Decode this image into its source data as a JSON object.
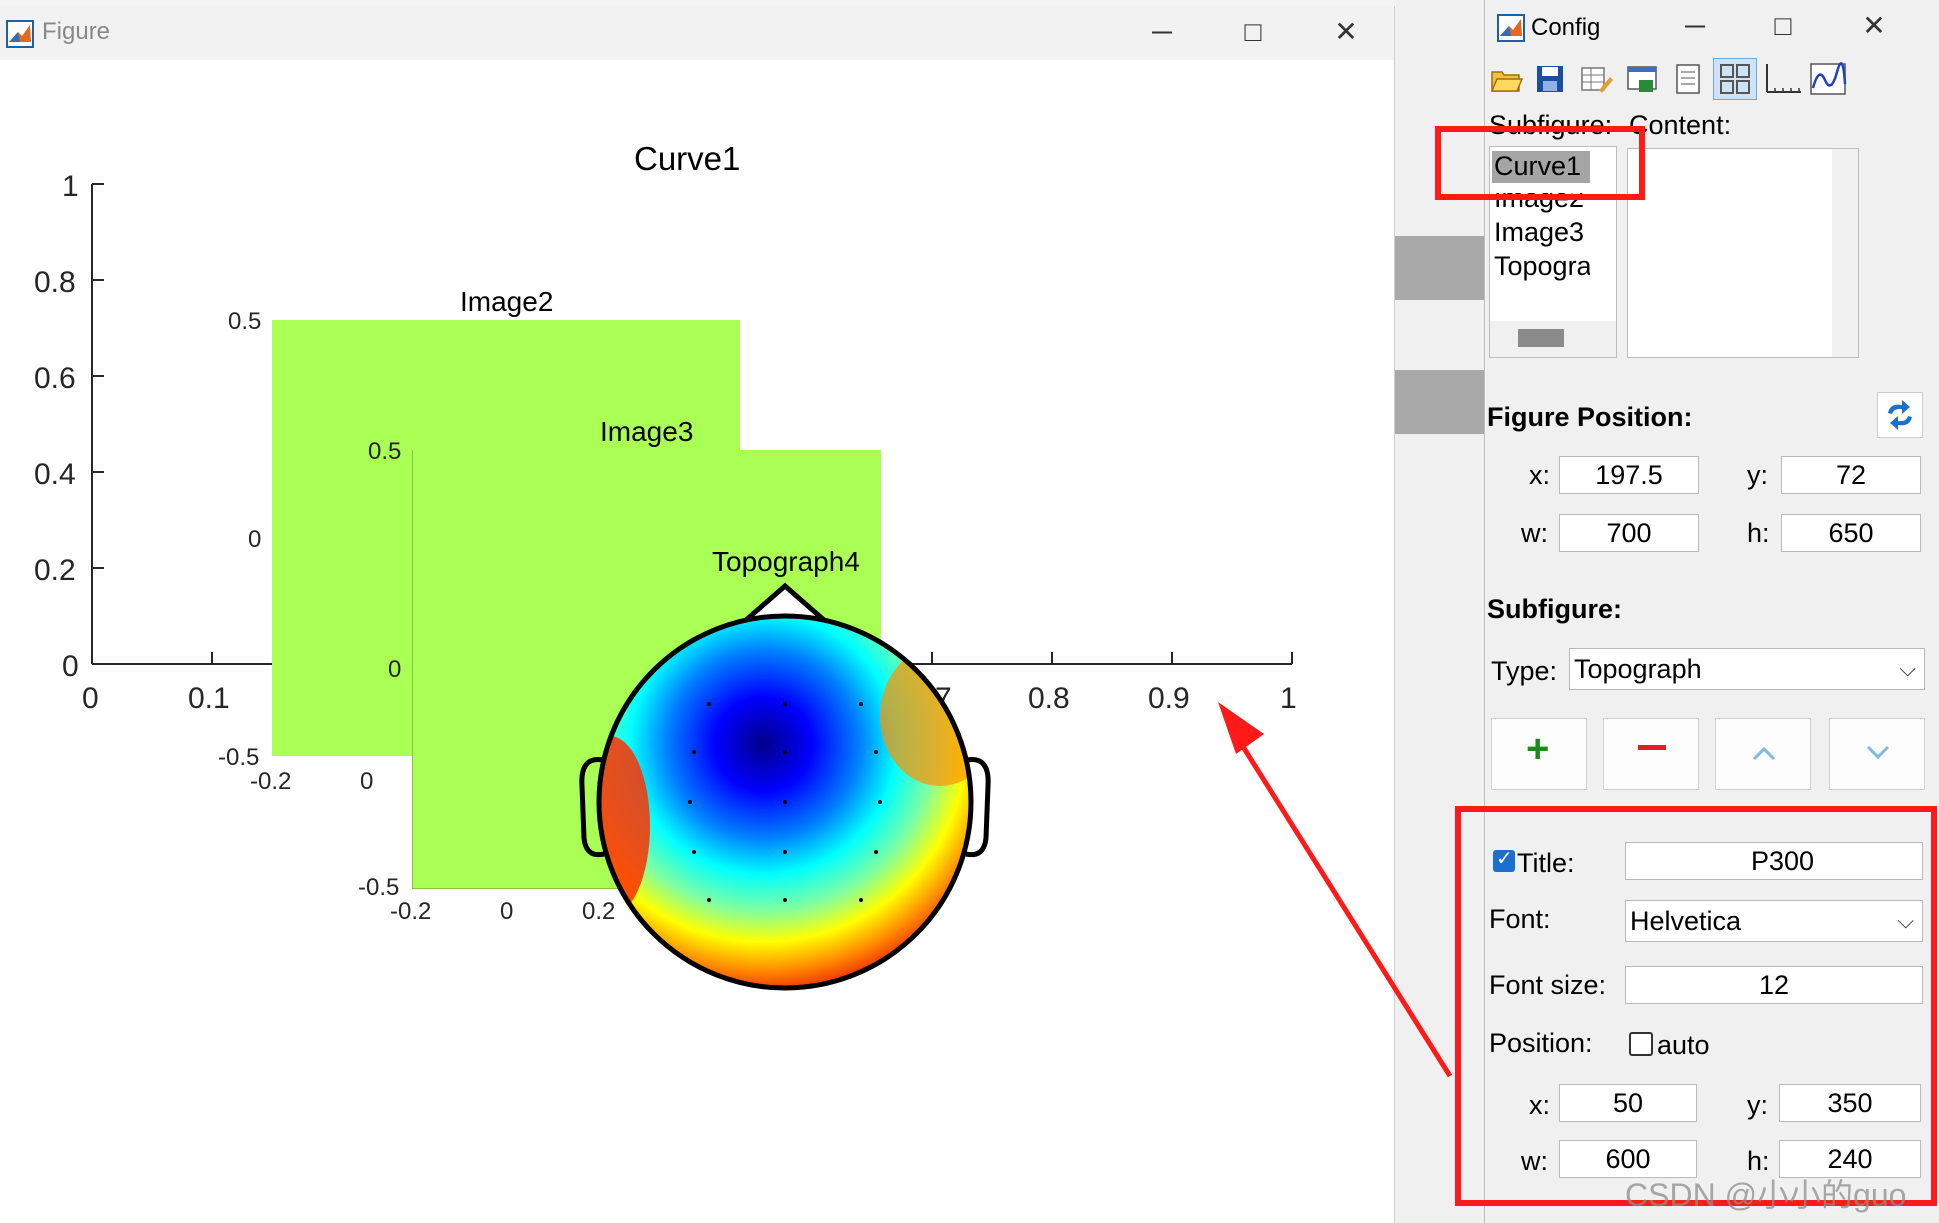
{
  "figure_window": {
    "title": "Figure",
    "curve": {
      "title": "Curve1",
      "y_ticks": [
        "1",
        "0.8",
        "0.6",
        "0.4",
        "0.2",
        "0"
      ],
      "x_ticks": [
        "0",
        "0.1",
        "0.7",
        "0.8",
        "0.9",
        "1"
      ]
    },
    "image2": {
      "title": "Image2",
      "y_ticks": [
        "0.5",
        "0",
        "-0.5"
      ],
      "x_ticks": [
        "-0.2",
        "0"
      ]
    },
    "image3": {
      "title": "Image3",
      "y_ticks": [
        "0.5",
        "0",
        "-0.5"
      ],
      "x_ticks": [
        "-0.2",
        "0",
        "0.2"
      ]
    },
    "topograph": {
      "title": "Topograph4"
    },
    "colors": {
      "image_fill": "#aaff55",
      "annotation": "#ff1a1a"
    }
  },
  "config_window": {
    "title": "Config",
    "toolbar_icons": [
      "open-folder-icon",
      "save-icon",
      "edit-table-icon",
      "export-figure-icon",
      "document-icon",
      "grid-layout-icon",
      "axis-icon",
      "waveform-icon"
    ],
    "subfigure_label": "Subfigure:",
    "content_label": "Content:",
    "subfigure_list": [
      "Curve1",
      "Image2",
      "Image3",
      "Topograph"
    ],
    "selected_subfigure": "Curve1",
    "figure_position": {
      "heading": "Figure Position:",
      "x_label": "x:",
      "x": "197.5",
      "y_label": "y:",
      "y": "72",
      "w_label": "w:",
      "w": "700",
      "h_label": "h:",
      "h": "650"
    },
    "subfigure_section": {
      "heading": "Subfigure:",
      "type_label": "Type:",
      "type_value": "Topograph",
      "buttons": [
        "add",
        "remove",
        "move-up",
        "move-down"
      ]
    },
    "title_settings": {
      "title_label": "Title:",
      "title_checked": true,
      "title_value": "P300",
      "font_label": "Font:",
      "font_value": "Helvetica",
      "font_size_label": "Font size:",
      "font_size_value": "12",
      "position_label": "Position:",
      "auto_label": "auto",
      "auto_checked": false,
      "x_label": "x:",
      "x": "50",
      "y_label": "y:",
      "y": "350",
      "w_label": "w:",
      "w": "600",
      "h_label": "h:",
      "h": "240"
    },
    "watermark": "CSDN @小小的guo"
  }
}
